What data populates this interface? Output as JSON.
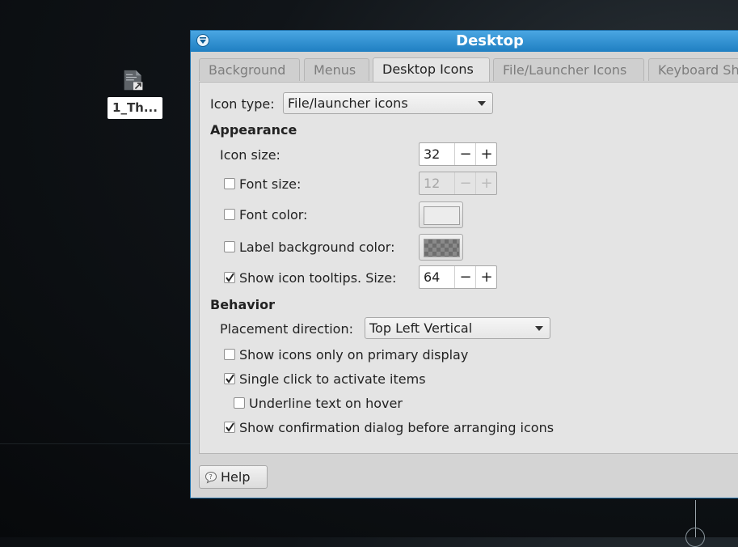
{
  "desktop": {
    "icon_label": "1_Th..."
  },
  "window": {
    "title": "Desktop",
    "tabs": [
      "Background",
      "Menus",
      "Desktop Icons",
      "File/Launcher Icons",
      "Keyboard Sh"
    ],
    "active_tab": "Desktop Icons",
    "icon_type_label": "Icon type:",
    "icon_type_value": "File/launcher icons",
    "appearance": {
      "heading": "Appearance",
      "icon_size_label": "Icon size:",
      "icon_size_value": "32",
      "font_size_label": "Font size:",
      "font_size_value": "12",
      "font_size_checked": false,
      "font_color_label": "Font color:",
      "font_color_checked": false,
      "font_color_swatch": "#ececec",
      "label_bg_label": "Label background color:",
      "label_bg_checked": false,
      "tooltips_label": "Show icon tooltips. Size:",
      "tooltips_checked": true,
      "tooltips_size_value": "64",
      "minus_glyph": "−",
      "plus_glyph": "+"
    },
    "behavior": {
      "heading": "Behavior",
      "placement_label": "Placement direction:",
      "placement_value": "Top Left Vertical",
      "primary_display_label": "Show icons only on primary display",
      "primary_display_checked": false,
      "single_click_label": "Single click to activate items",
      "single_click_checked": true,
      "underline_label": "Underline text on hover",
      "underline_checked": false,
      "confirm_label": "Show confirmation dialog before arranging icons",
      "confirm_checked": true
    },
    "help_label": "Help"
  },
  "colors": {
    "titlebar": "#1f7fc2",
    "window_bg": "#d4d4d4",
    "panel_bg": "#e4e4e4"
  }
}
